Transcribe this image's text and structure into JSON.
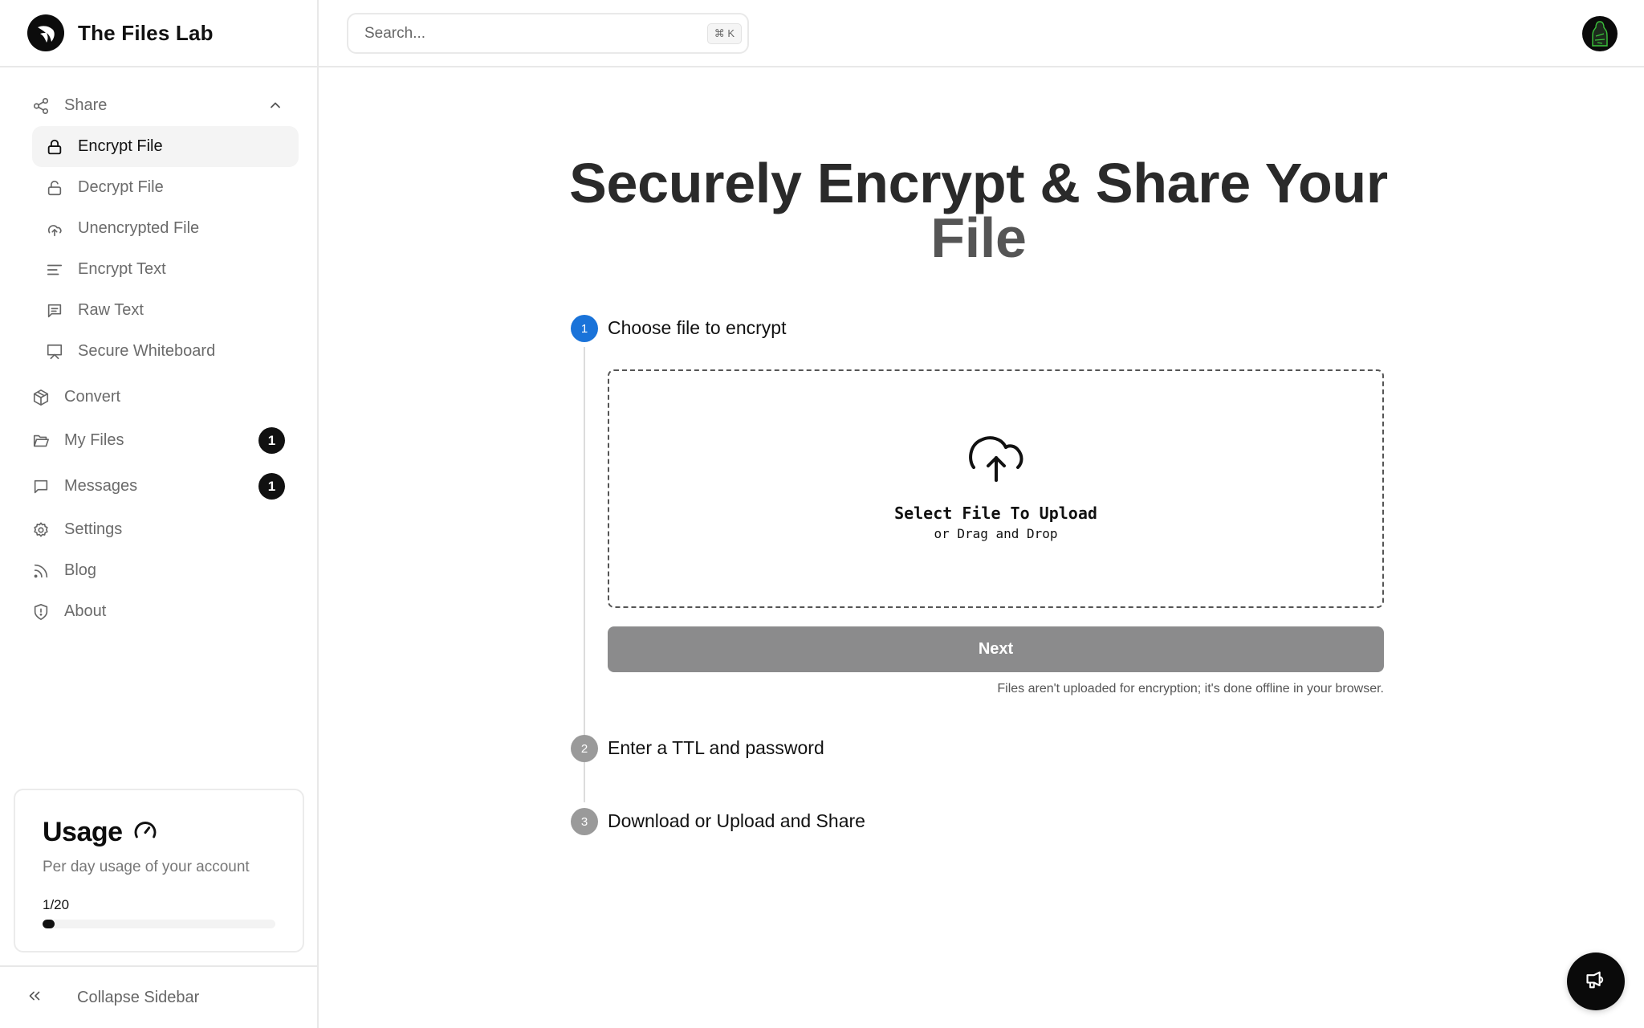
{
  "app": {
    "name": "The Files Lab"
  },
  "header": {
    "search_placeholder": "Search...",
    "search_value": "",
    "shortcut": "⌘ K"
  },
  "sidebar": {
    "share": {
      "label": "Share",
      "expanded": true,
      "items": [
        {
          "label": "Encrypt File",
          "icon": "lock-icon",
          "active": true
        },
        {
          "label": "Decrypt File",
          "icon": "unlock-icon",
          "active": false
        },
        {
          "label": "Unencrypted File",
          "icon": "cloud-upload-icon",
          "active": false
        },
        {
          "label": "Encrypt Text",
          "icon": "text-align-icon",
          "active": false
        },
        {
          "label": "Raw Text",
          "icon": "message-text-icon",
          "active": false
        },
        {
          "label": "Secure Whiteboard",
          "icon": "presentation-icon",
          "active": false
        }
      ]
    },
    "items": [
      {
        "label": "Convert",
        "icon": "package-icon"
      },
      {
        "label": "My Files",
        "icon": "folder-open-icon",
        "badge": "1"
      },
      {
        "label": "Messages",
        "icon": "message-square-icon",
        "badge": "1"
      },
      {
        "label": "Settings",
        "icon": "gear-icon"
      },
      {
        "label": "Blog",
        "icon": "rss-icon"
      },
      {
        "label": "About",
        "icon": "shield-alert-icon"
      }
    ],
    "usage": {
      "title": "Usage",
      "description": "Per day usage of your account",
      "count_label": "1/20",
      "used": 1,
      "limit": 20
    },
    "collapse_label": "Collapse Sidebar"
  },
  "main": {
    "title_line1": "Securely Encrypt & Share Your",
    "title_line2": "File",
    "steps": [
      {
        "number": "1",
        "label": "Choose file to encrypt",
        "state": "active",
        "color": "#1a73d9"
      },
      {
        "number": "2",
        "label": "Enter a TTL and password",
        "state": "pending",
        "color": "#9a9a9a"
      },
      {
        "number": "3",
        "label": "Download or Upload and Share",
        "state": "pending",
        "color": "#9a9a9a"
      }
    ],
    "dropzone": {
      "title": "Select File To Upload",
      "subtitle": "or Drag and Drop"
    },
    "next_label": "Next",
    "note": "Files aren't uploaded for encryption; it's done offline in your browser."
  },
  "colors": {
    "accent": "#1a73d9",
    "button_disabled": "#8b8b8c",
    "badge": "#111111"
  }
}
